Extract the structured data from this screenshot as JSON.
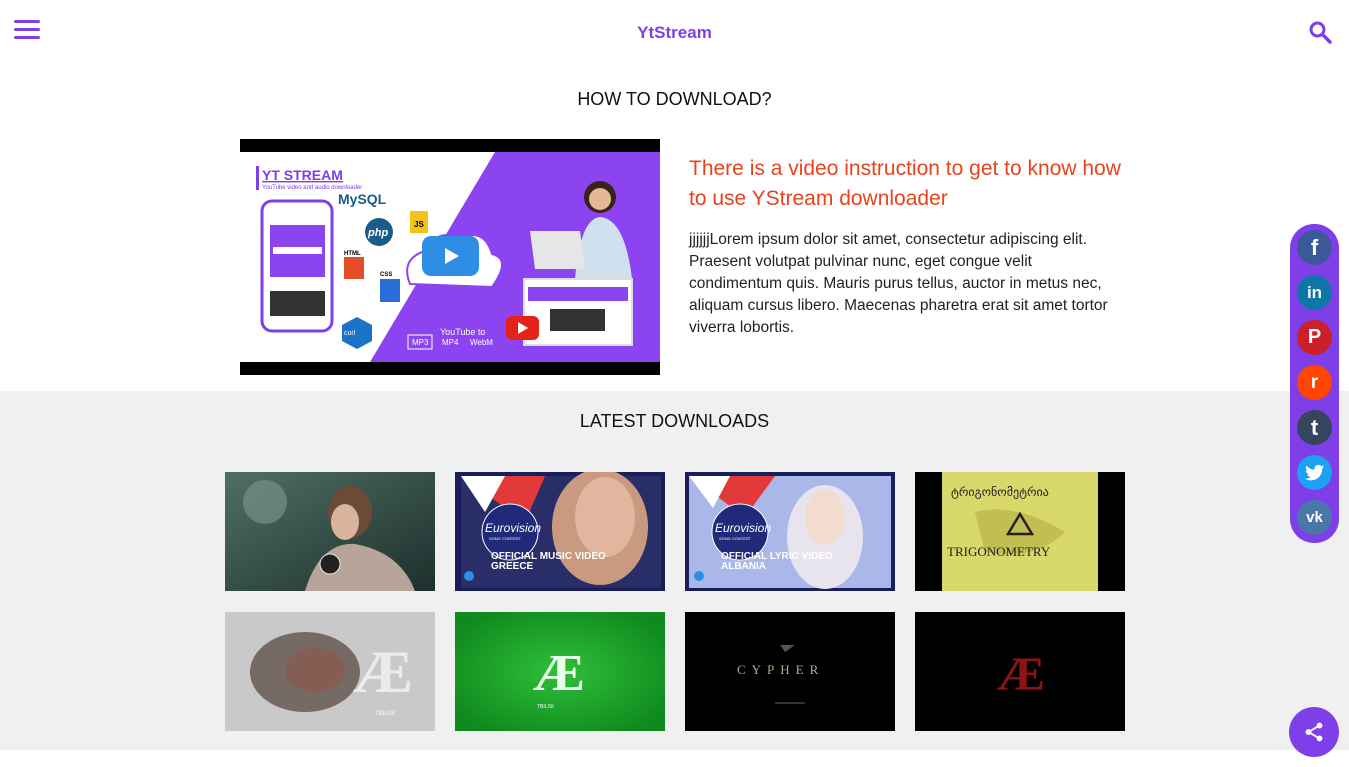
{
  "header": {
    "brand": "YtStream",
    "menu_icon": "hamburger-menu-icon",
    "search_icon": "search-icon",
    "accent": "#7e3fe8"
  },
  "howto": {
    "title": "HOW TO DOWNLOAD?",
    "heading": "There is a video instruction to get to know how to use YStream downloader",
    "description": "jjjjjjLorem ipsum dolor sit amet, consectetur adipiscing elit. Praesent volutpat pulvinar nunc, eget congue velit condimentum quis. Mauris purus tellus, auctor in metus nec, aliquam cursus libero. Maecenas pharetra erat sit amet tortor viverra lobortis.",
    "heading_color": "#e8431c",
    "video": {
      "logo_text": "YT STREAM",
      "logo_subtitle": "YouTube video and audio downloader",
      "tech_labels": [
        "MySQL",
        "php",
        "JS",
        "HTML",
        "CSS",
        "curl"
      ],
      "format_caption": "YouTube to",
      "formats": [
        "MP3",
        "MP4",
        "WebM"
      ]
    }
  },
  "latest": {
    "title": "LATEST DOWNLOADS",
    "items": [
      {
        "overlay_lines": []
      },
      {
        "overlay_lines": [
          "Eurovision",
          "SONG CONTEST",
          "OFFICIAL MUSIC VIDEO",
          "GREECE"
        ]
      },
      {
        "overlay_lines": [
          "Eurovision",
          "SONG CONTEST",
          "OFFICIAL LYRIC VIDEO",
          "ALBANIA"
        ]
      },
      {
        "overlay_lines": [
          "ტრიგონომეტრია",
          "TRIGONOMETRY"
        ]
      },
      {
        "overlay_lines": [
          "TBILISI"
        ]
      },
      {
        "overlay_lines": [
          "TBILISI"
        ]
      },
      {
        "overlay_lines": [
          "CYPHER"
        ]
      },
      {
        "overlay_lines": []
      }
    ]
  },
  "social": {
    "buttons": [
      {
        "name": "facebook",
        "glyph": "f",
        "color": "#3b5998"
      },
      {
        "name": "linkedin",
        "glyph": "in",
        "color": "#0e76a8"
      },
      {
        "name": "pinterest",
        "glyph": "P",
        "color": "#cb2027"
      },
      {
        "name": "reddit",
        "glyph": "r",
        "color": "#ff4500"
      },
      {
        "name": "tumblr",
        "glyph": "t",
        "color": "#35465c"
      },
      {
        "name": "twitter",
        "glyph": "t",
        "color": "#1da1f2"
      },
      {
        "name": "vk",
        "glyph": "vk",
        "color": "#4a76a8"
      }
    ],
    "share_icon": "share-icon"
  }
}
